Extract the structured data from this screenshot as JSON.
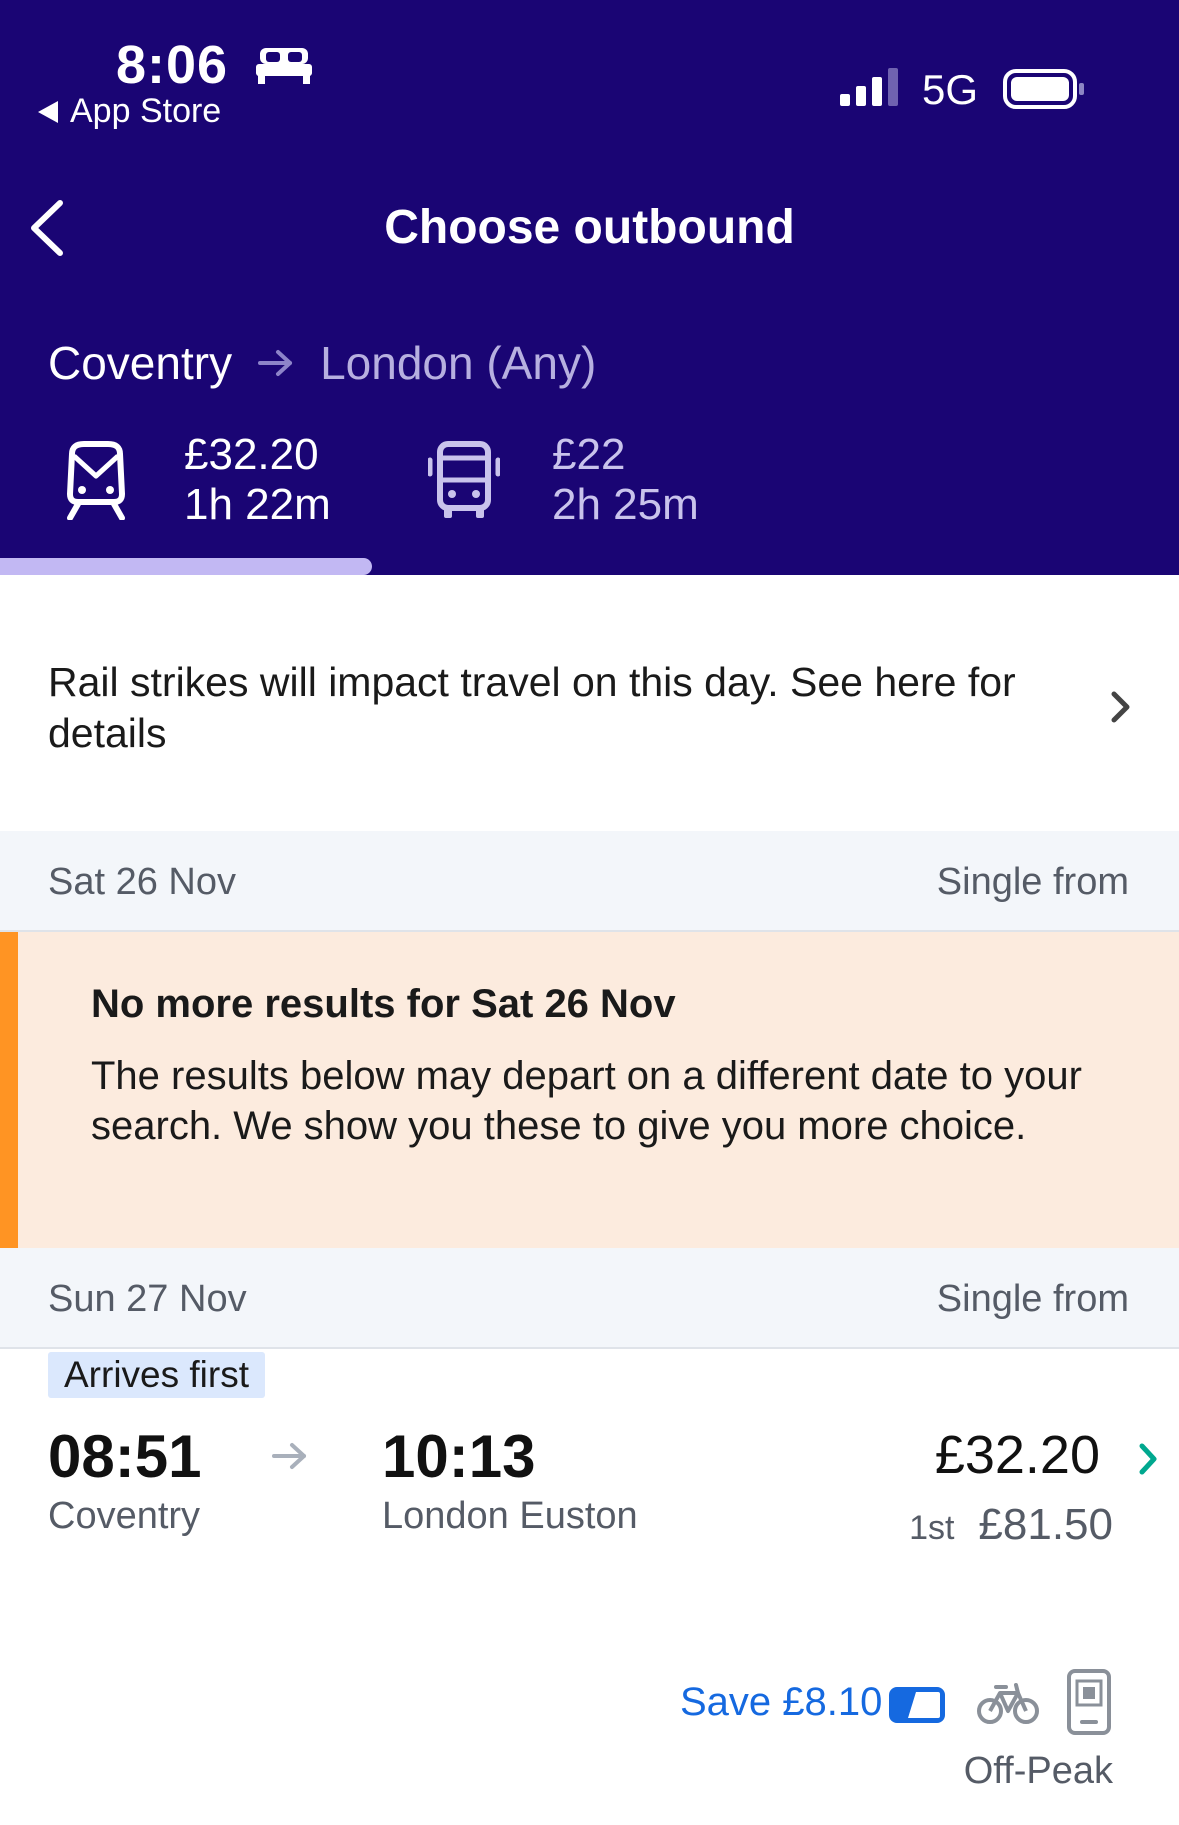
{
  "status_bar": {
    "time": "8:06",
    "back_label": "App Store",
    "network": "5G"
  },
  "nav": {
    "title": "Choose outbound"
  },
  "route": {
    "from": "Coventry",
    "to": "London (Any)"
  },
  "modes": [
    {
      "type": "train",
      "price": "£32.20",
      "duration": "1h 22m",
      "selected": true
    },
    {
      "type": "bus",
      "price": "£22",
      "duration": "2h 25m",
      "selected": false
    }
  ],
  "strike_banner": {
    "text": "Rail strikes will impact travel on this day. See here for details"
  },
  "date_sections": [
    {
      "date": "Sat 26 Nov",
      "label": "Single from"
    },
    {
      "date": "Sun 27 Nov",
      "label": "Single from"
    }
  ],
  "notice": {
    "title": "No more results for Sat 26 Nov",
    "body": "The results below may depart on a different date to your search. We show you these to give you more choice.",
    "accent_color": "#ff9423"
  },
  "journey": {
    "tag": "Arrives first",
    "departure_time": "08:51",
    "departure_station": "Coventry",
    "arrival_time": "10:13",
    "arrival_station": "London Euston",
    "price": "£32.20",
    "first_class_label": "1st",
    "first_class_price": "£81.50",
    "save_text": "Save £8.10",
    "ticket_type": "Off-Peak",
    "icons": [
      "railcard-icon",
      "bike-icon",
      "mticket-icon"
    ]
  },
  "colors": {
    "header_bg": "#1a0574",
    "save_blue": "#1569e0",
    "chevron_green": "#00a88f"
  }
}
